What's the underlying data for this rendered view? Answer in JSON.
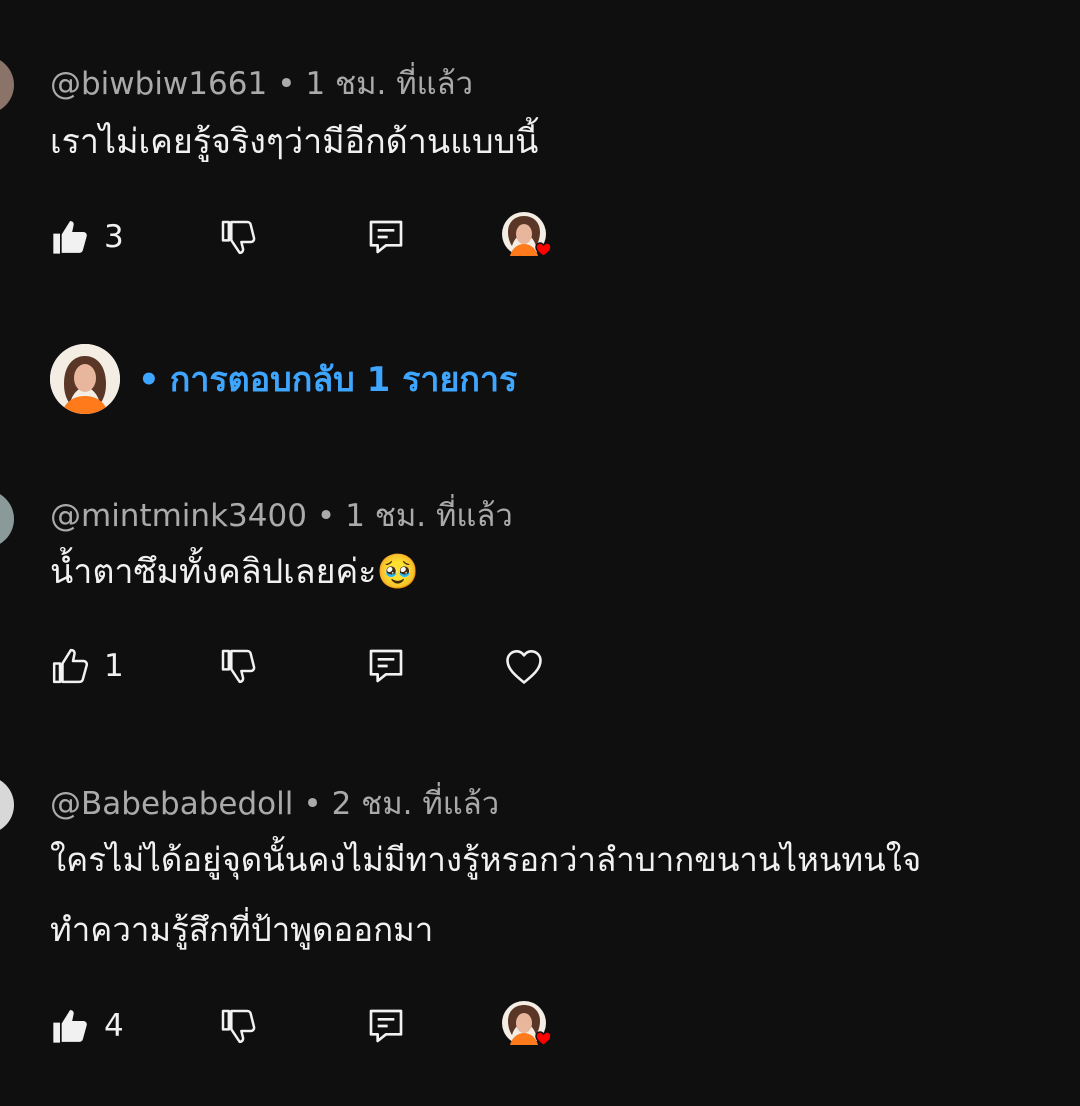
{
  "comments": [
    {
      "handle": "@biwbiw1661",
      "time": "1 ชม. ที่แล้ว",
      "text_lines": [
        "เราไม่เคยรู้จริงๆว่ามีอีกด้านแบบนี้"
      ],
      "likes": "3",
      "liked": true,
      "creator_hearted": true
    },
    {
      "handle": "@mintmink3400",
      "time": "1 ชม. ที่แล้ว",
      "text_lines": [
        "น้ำตาซึมทั้งคลิปเลยค่ะ🥹"
      ],
      "likes": "1",
      "liked": false,
      "creator_hearted": false
    },
    {
      "handle": "@Babebabedoll",
      "time": "2 ชม. ที่แล้ว",
      "text_lines": [
        "ใครไม่ได้อยู่จุดนั้นคงไม่มีทางรู้หรอกว่าลำบากขนานไหนทนใจ",
        "ทำความรู้สึกที่ป้าพูดออกมา"
      ],
      "likes": "4",
      "liked": true,
      "creator_hearted": true
    }
  ],
  "reply_thread": {
    "label": "การตอบกลับ 1 รายการ"
  },
  "colors": {
    "background": "#0f0f0f",
    "primary_text": "#f1f1f1",
    "secondary_text": "#aaaaaa",
    "link": "#3ea6ff",
    "heart": "#ff0000"
  },
  "icons": [
    "like-icon",
    "dislike-icon",
    "reply-icon",
    "heart-icon",
    "creator-heart-badge"
  ]
}
